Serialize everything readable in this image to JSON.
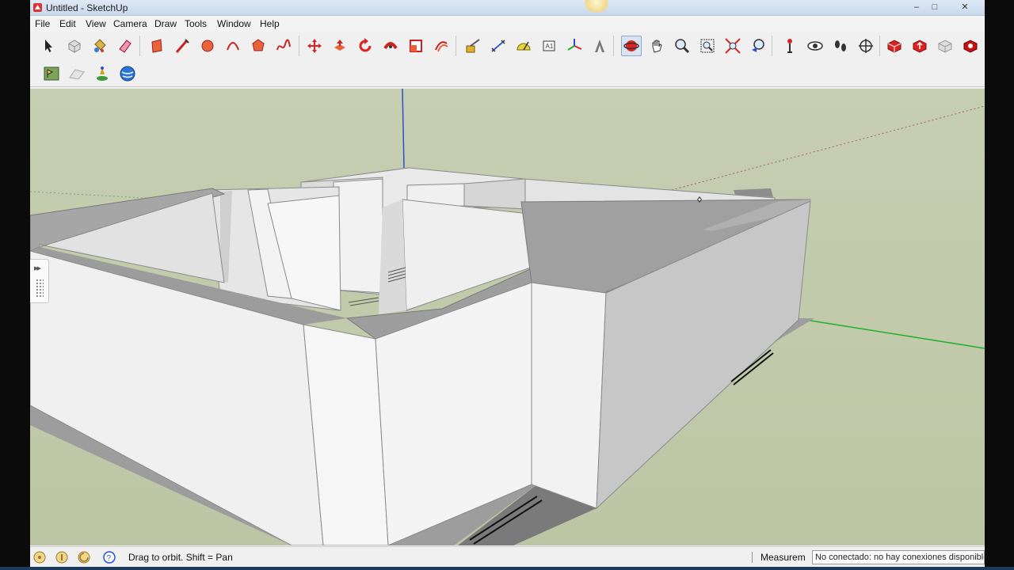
{
  "window": {
    "title": "Untitled - SketchUp",
    "controls": {
      "minimize": "–",
      "maximize": "□",
      "close": "✕"
    }
  },
  "menu": [
    "File",
    "Edit",
    "View",
    "Camera",
    "Draw",
    "Tools",
    "Window",
    "Help"
  ],
  "toolbar_main": [
    "select-icon",
    "make-component-icon",
    "paint-bucket-icon",
    "eraser-icon",
    "rectangle-icon",
    "line-icon",
    "circle-icon",
    "arc-icon",
    "polygon-icon",
    "freehand-icon",
    "move-icon",
    "push-pull-icon",
    "rotate-icon",
    "follow-me-icon",
    "scale-icon",
    "offset-icon",
    "tape-measure-icon",
    "dimension-icon",
    "protractor-icon",
    "text-icon",
    "axes-icon",
    "3d-text-icon",
    "orbit-icon",
    "pan-icon",
    "zoom-icon",
    "zoom-window-icon",
    "zoom-extents-icon",
    "previous-view-icon",
    "position-camera-icon",
    "look-around-icon",
    "walk-icon",
    "section-plane-icon",
    "get-models-icon",
    "share-model-icon",
    "share-component-icon",
    "extension-warehouse-icon"
  ],
  "toolbar_secondary": [
    "add-location-icon",
    "toggle-terrain-icon",
    "preview-google-earth-icon",
    "get-current-view-icon"
  ],
  "active_tool": "orbit-icon",
  "statusbar": {
    "hint": "Drag to orbit.  Shift = Pan",
    "measurements_label": "Measurem",
    "notification": "No conectado: no hay conexiones disponibles"
  },
  "colors": {
    "ground": "#c0c9aa",
    "sky": "#c5ccb0",
    "wall_light": "#efefef",
    "wall_shade": "#bdbdbd",
    "wall_top": "#9c9c9c",
    "axis_blue": "#2a4fd6",
    "axis_green": "#1db02a",
    "axis_red": "#d23030"
  }
}
